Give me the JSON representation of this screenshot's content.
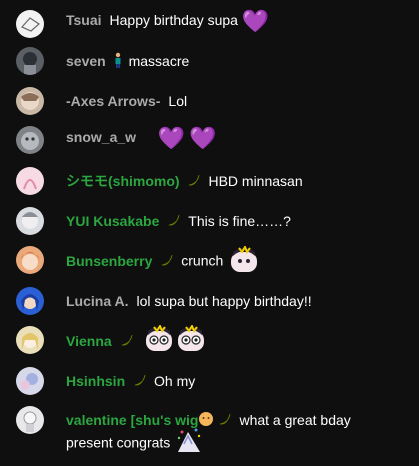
{
  "messages": [
    {
      "author": "Tsuai",
      "text": "Happy birthday supa",
      "heart": "💜",
      "color": "#aaaaaa"
    },
    {
      "author": "seven",
      "text": "massacre",
      "icon": "person-icon"
    },
    {
      "author": "-Axes Arrows-",
      "text": "Lol"
    },
    {
      "author": "snow_a_w",
      "heart1": "💜",
      "heart2": "💜"
    },
    {
      "author": "シモモ(shimomo)",
      "text": "HBD minnasan",
      "member": true
    },
    {
      "author": "YUI Kusakabe",
      "text": "This is fine……?",
      "member": true
    },
    {
      "author": "Bunsenberry",
      "text": "crunch",
      "member": true
    },
    {
      "author": "Lucina A.",
      "text": "lol supa but happy birthday!!"
    },
    {
      "author": "Vienna",
      "member": true
    },
    {
      "author": "Hsinhsin",
      "text": "Oh my",
      "member": true
    },
    {
      "author": "valentine [shu's wig",
      "text": "what a great bday",
      "text2": "present congrats",
      "member": true
    }
  ],
  "colors": {
    "member": "#2ba640",
    "author": "#aaaaaa",
    "heart": "#9b2de0",
    "banana": "#c8d400"
  }
}
